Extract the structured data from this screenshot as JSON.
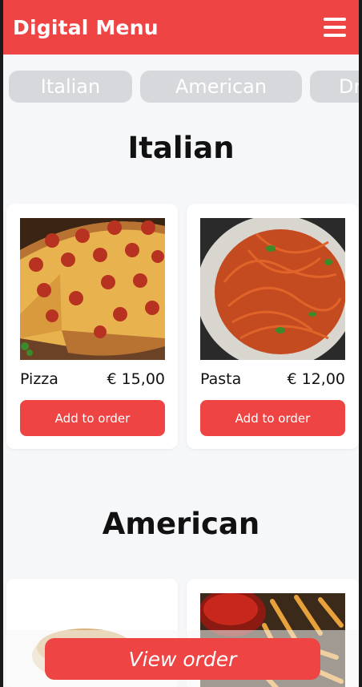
{
  "header": {
    "title": "Digital Menu",
    "menu_icon": "hamburger-menu-icon"
  },
  "tabs": [
    {
      "label": "Italian"
    },
    {
      "label": "American"
    },
    {
      "label": "Dr"
    }
  ],
  "sections": [
    {
      "title": "Italian",
      "items": [
        {
          "name": "Pizza",
          "price": "€ 15,00",
          "button": "Add to order",
          "image": "pizza-image"
        },
        {
          "name": "Pasta",
          "price": "€ 12,00",
          "button": "Add to order",
          "image": "pasta-image"
        }
      ]
    },
    {
      "title": "American",
      "items": [
        {
          "image": "burger-image"
        },
        {
          "image": "fries-image"
        }
      ]
    }
  ],
  "footer": {
    "view_order_label": "View order"
  },
  "colors": {
    "accent": "#ef4444",
    "tab_bg": "#d6d8db",
    "background": "#f6f7f8"
  }
}
